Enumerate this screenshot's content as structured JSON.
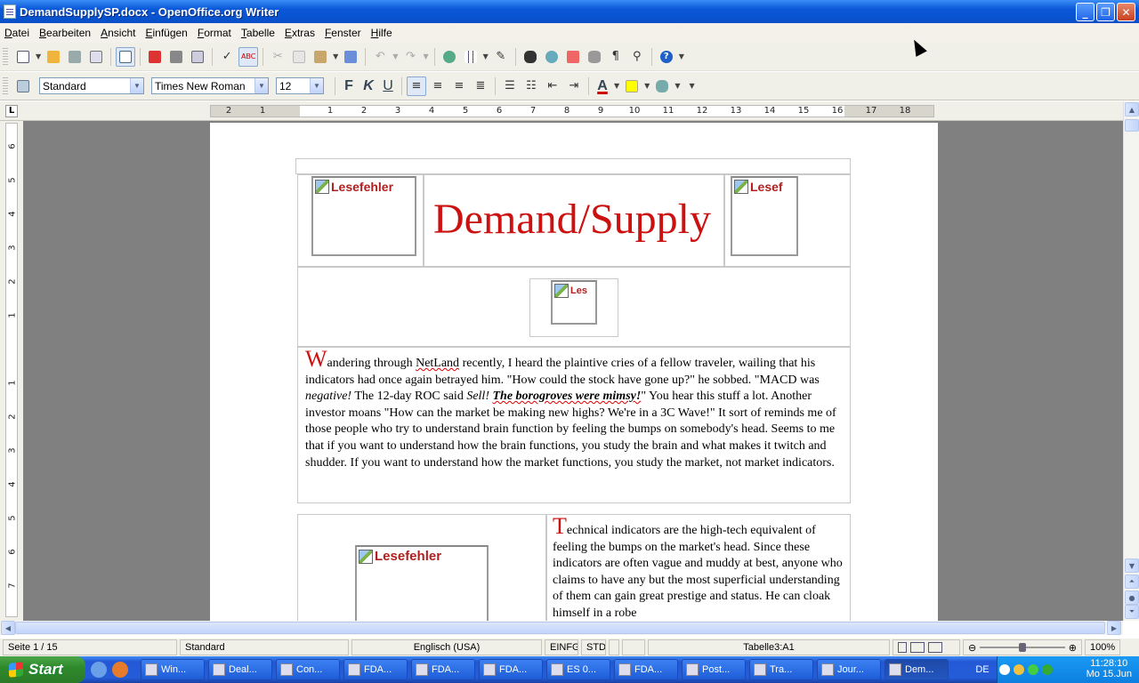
{
  "window": {
    "title": "DemandSupplySP.docx - OpenOffice.org Writer",
    "minimize": "_",
    "restore": "❐",
    "close": "✕"
  },
  "menu": [
    "Datei",
    "Bearbeiten",
    "Ansicht",
    "Einfügen",
    "Format",
    "Tabelle",
    "Extras",
    "Fenster",
    "Hilfe"
  ],
  "toolbar2": {
    "style": "Standard",
    "font": "Times New Roman",
    "size": "12",
    "bold": "F",
    "italic": "K",
    "underline": "U",
    "font_color_letter": "A"
  },
  "ruler": {
    "h_numbers": [
      "2",
      "1",
      "1",
      "2",
      "3",
      "4",
      "5",
      "6",
      "7",
      "8",
      "9",
      "10",
      "11",
      "12",
      "13",
      "14",
      "15",
      "16",
      "17",
      "18"
    ],
    "v_numbers": [
      "6",
      "5",
      "4",
      "3",
      "2",
      "1",
      "1",
      "1",
      "2",
      "3",
      "4",
      "5",
      "6",
      "7"
    ],
    "corner": "L"
  },
  "document": {
    "image_placeholder": "Lesefehler",
    "image_placeholder_right": "Lesef",
    "image_placeholder_small": "Les",
    "heading": "Demand/Supply",
    "para1": {
      "drop": "W",
      "t1": "andering through ",
      "netland": "NetLand",
      "t2": " recently, I heard the plaintive cries of a fellow traveler, wailing that his indicators had once again betrayed him. \"How could the stock have gone up?\" he sobbed. \"MACD was ",
      "negative": "negative!",
      "t3": " The 12-day ROC said ",
      "sell": "Sell!",
      "t4": " ",
      "boro": "The borogroves were mimsy!",
      "t5": "\" You hear this stuff a lot. Another investor moans \"How can the market be making new highs? We're in a 3C Wave!\" It sort of reminds me of those people who try to understand brain function by feeling the bumps on somebody's head. Seems to me that if you want to understand how the brain functions, you study the brain and what makes it twitch and shudder. If you want to understand how the market functions, you study the market, not market indicators."
    },
    "para2": {
      "drop": "T",
      "text": "echnical indicators are the high-tech equivalent of feeling the bumps on the market's head. Since these indicators are often vague and muddy at best, anyone who claims to have any but the most superficial understanding of them can gain great prestige and status. He can cloak himself in a robe"
    }
  },
  "status": {
    "page": "Seite 1 / 15",
    "style": "Standard",
    "language": "Englisch (USA)",
    "insert": "EINFG",
    "std": "STD",
    "table": "Tabelle3:A1",
    "zoom": "100%"
  },
  "taskbar": {
    "start": "Start",
    "tasks": [
      "Win...",
      "Deal...",
      "Con...",
      "FDA...",
      "FDA...",
      "FDA...",
      "ES 0...",
      "FDA...",
      "Post...",
      "Tra...",
      "Jour...",
      "Dem..."
    ],
    "lang": "DE",
    "time": "11:28:10",
    "date": "Mo 15.Jun"
  }
}
